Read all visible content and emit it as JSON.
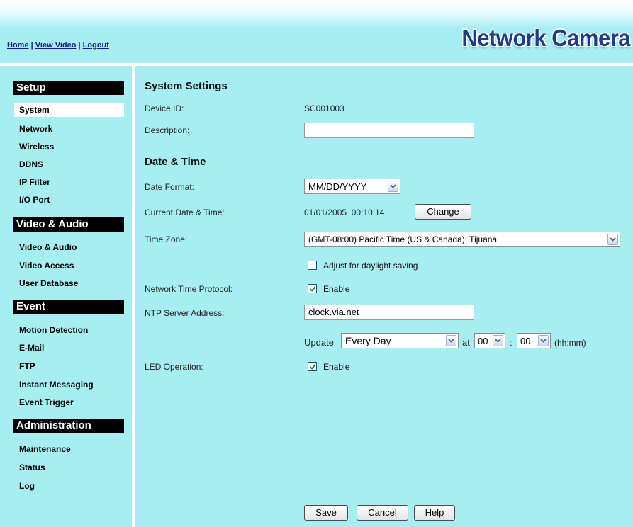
{
  "top": {
    "links": [
      "Home",
      "View Video",
      "Logout"
    ],
    "separator": " | ",
    "brand": "Network Camera"
  },
  "sidebar": {
    "sections": [
      {
        "title": "Setup",
        "items": [
          "System",
          "Network",
          "Wireless",
          "DDNS",
          "IP Filter",
          "I/O Port"
        ]
      },
      {
        "title": "Video & Audio",
        "items": [
          "Video & Audio",
          "Video Access",
          "User Database"
        ]
      },
      {
        "title": "Event",
        "items": [
          "Motion Detection",
          "E-Mail",
          "FTP",
          "Instant Messaging",
          "Event Trigger"
        ]
      },
      {
        "title": "Administration",
        "items": [
          "Maintenance",
          "Status",
          "Log"
        ]
      }
    ],
    "selected": "System"
  },
  "main": {
    "system_title": "System Settings",
    "device_id_label": "Device ID:",
    "device_id_value": "SC001003",
    "description_label": "Description:",
    "description_value": "",
    "datetime_title": "Date & Time",
    "date_format_label": "Date Format:",
    "date_format_value": "MM/DD/YYYY",
    "current_dt_label": "Current Date & Time:",
    "current_dt_value": "01/01/2005  00:10:14",
    "change_button": "Change",
    "timezone_label": "Time Zone:",
    "timezone_value": "(GMT-08:00) Pacific Time (US & Canada); Tijuana",
    "daylight_label": "Adjust for daylight saving",
    "daylight_checked": false,
    "ntp_label": "Network Time Protocol:",
    "ntp_enable_label": "Enable",
    "ntp_checked": true,
    "ntp_server_label": "NTP Server Address:",
    "ntp_server_value": "clock.via.net",
    "update_label": "Update",
    "update_value": "Every Day",
    "at_label": "at",
    "hour_value": "00",
    "colon": ":",
    "minute_value": "00",
    "hhmm_label": "(hh:mm)",
    "led_label": "LED Operation:",
    "led_enable_label": "Enable",
    "led_checked": true
  },
  "footer": {
    "save": "Save",
    "cancel": "Cancel",
    "help": "Help"
  },
  "colors": {
    "background": "#a6eef2",
    "brand": "#1f3c87",
    "link": "#1a1a8c",
    "section_header": "#000000"
  }
}
